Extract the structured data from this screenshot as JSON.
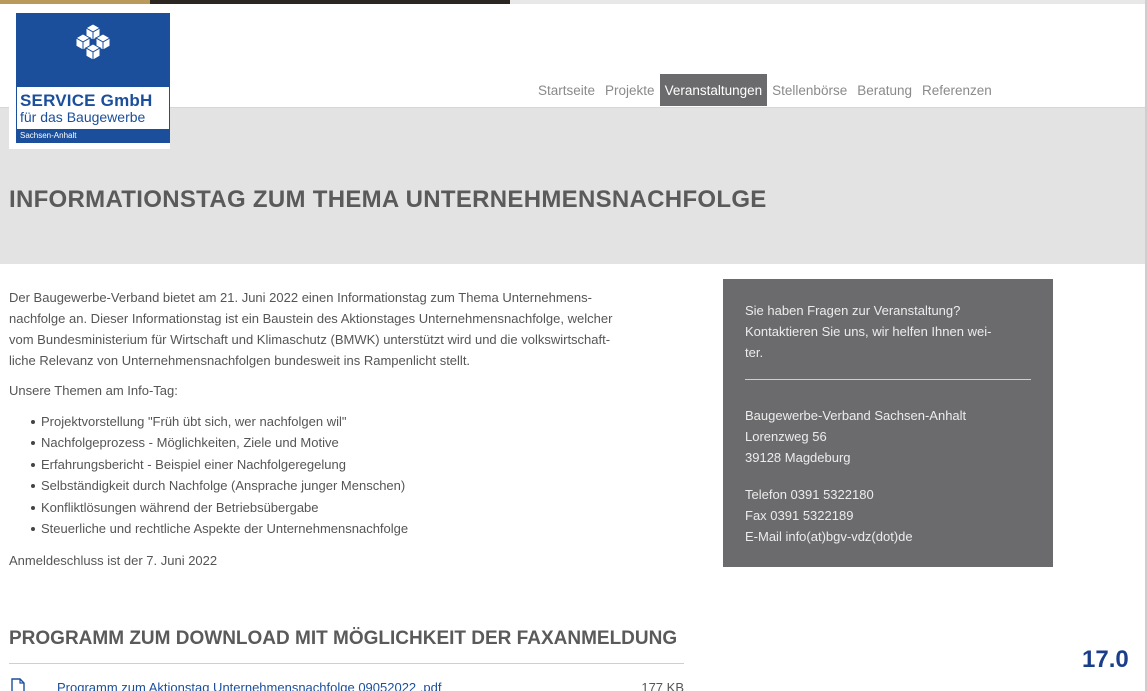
{
  "logo": {
    "title": "SERVICE GmbH",
    "subtitle": "für das Baugewerbe",
    "region": "Sachsen-Anhalt",
    "brand_color": "#1b4f9c"
  },
  "nav": {
    "items": [
      {
        "label": "Startseite",
        "active": false
      },
      {
        "label": "Projekte",
        "active": false
      },
      {
        "label": "Veranstaltungen",
        "active": true
      },
      {
        "label": "Stellenbörse",
        "active": false
      },
      {
        "label": "Beratung",
        "active": false
      },
      {
        "label": "Referenzen",
        "active": false
      }
    ],
    "active_color": "#6b6b6e"
  },
  "page": {
    "title": "INFORMATIONSTAG ZUM THEMA UNTERNEHMENSNACHFOLGE"
  },
  "content": {
    "intro_lines": [
      "Der Baugewerbe-Verband bietet am 21. Juni 2022 einen Informationstag zum Thema Unternehmens-",
      "nachfolge an. Dieser Informationstag ist ein Baustein des Aktionstages Unternehmensnachfolge, welcher",
      "vom Bundesministerium für Wirtschaft und Klimaschutz (BMWK) unterstützt wird und die volkswirtschaft-",
      "liche Relevanz von Unternehmensnachfolgen bundesweit ins Rampenlicht stellt."
    ],
    "themes_label": "Unsere Themen am Info-Tag:",
    "themes": [
      "Projektvorstellung \"Früh übt sich, wer nachfolgen wil\"",
      "Nachfolgeprozess - Möglichkeiten, Ziele und Motive",
      "Erfahrungsbericht - Beispiel einer Nachfolgeregelung",
      "Selbständigkeit durch Nachfolge (Ansprache junger Menschen)",
      "Konfliktlösungen während der Betriebsübergabe",
      "Steuerliche und rechtliche Aspekte der Unternehmensnachfolge"
    ],
    "deadline": "Anmeldeschluss ist der 7. Juni 2022"
  },
  "download": {
    "section_title": "PROGRAMM ZUM DOWNLOAD MIT MÖGLICHKEIT DER FAXANMELDUNG",
    "file_name": "Programm zum Aktionstag Unternehmensnachfolge 09052022 .pdf",
    "file_size": "177 KB",
    "icon": "pdf-file-icon"
  },
  "contact": {
    "question_lines": [
      "Sie haben Fragen zur Veranstaltung?",
      "Kontaktieren Sie uns, wir helfen Ihnen wei-",
      "ter."
    ],
    "address_lines": [
      "Baugewerbe-Verband Sachsen-Anhalt",
      "Lorenzweg 56",
      "39128 Magdeburg"
    ],
    "phone": "Telefon 0391 5322180",
    "fax": "Fax 0391 5322189",
    "email": "E-Mail info(at)bgv-vdz(dot)de",
    "background_color": "#6b6b6e"
  },
  "corner_date": "17.0"
}
